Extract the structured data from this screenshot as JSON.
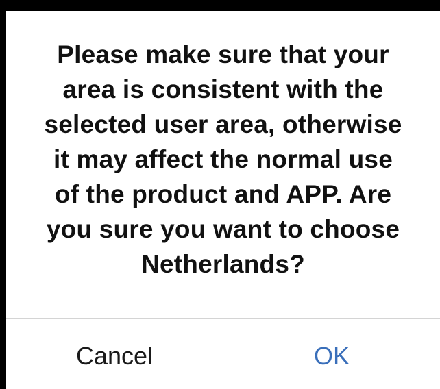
{
  "dialog": {
    "message_lines": [
      "Please make sure that your",
      "area is consistent with the",
      "selected user area, otherwise",
      "it may affect the normal use",
      "of the product and APP. Are",
      "you sure you want to choose",
      "Netherlands?"
    ],
    "cancel_label": "Cancel",
    "ok_label": "OK"
  },
  "colors": {
    "backdrop": "#000000",
    "dialog_background": "#ffffff",
    "message_text": "#111111",
    "ok_accent": "#3a6fba",
    "separator": "#d4d4d4"
  }
}
